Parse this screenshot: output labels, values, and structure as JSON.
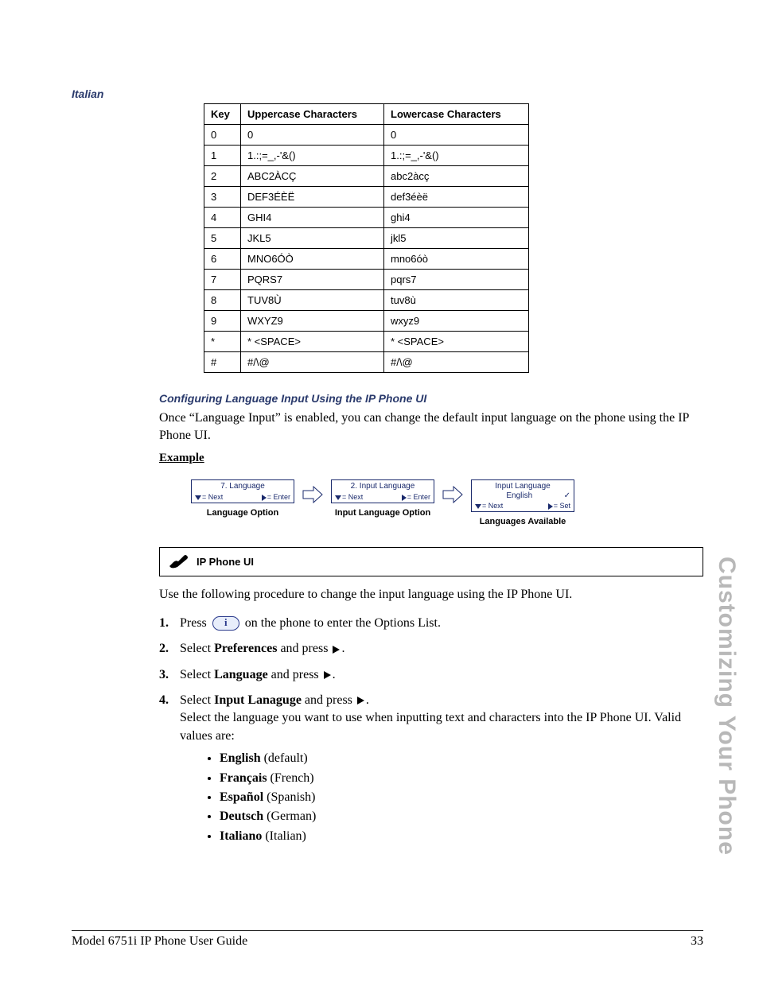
{
  "section_label": "Italian",
  "table": {
    "headers": {
      "key": "Key",
      "upper": "Uppercase Characters",
      "lower": "Lowercase Characters"
    },
    "rows": [
      {
        "k": "0",
        "u": "0",
        "l": "0"
      },
      {
        "k": "1",
        "u": "1.:;=_,-'&()",
        "l": "1.:;=_,-'&()"
      },
      {
        "k": "2",
        "u": "ABC2ÀCÇ",
        "l": "abc2àcç"
      },
      {
        "k": "3",
        "u": "DEF3ÉÈË",
        "l": "def3éèë"
      },
      {
        "k": "4",
        "u": "GHI4",
        "l": "ghi4"
      },
      {
        "k": "5",
        "u": "JKL5",
        "l": "jkl5"
      },
      {
        "k": "6",
        "u": "MNO6ÓÒ",
        "l": "mno6óò"
      },
      {
        "k": "7",
        "u": "PQRS7",
        "l": "pqrs7"
      },
      {
        "k": "8",
        "u": "TUV8Ù",
        "l": "tuv8ù"
      },
      {
        "k": "9",
        "u": "WXYZ9",
        "l": "wxyz9"
      },
      {
        "k": "*",
        "u": "* <SPACE>",
        "l": "* <SPACE>"
      },
      {
        "k": "#",
        "u": "#/\\@",
        "l": "#/\\@"
      }
    ]
  },
  "config_heading": "Configuring Language Input Using the IP Phone UI",
  "config_intro": "Once “Language Input” is enabled, you can change the default input language on the phone using the IP Phone UI.",
  "example_label": "Example",
  "screens": {
    "s1": {
      "title": "7. Language",
      "left": "= Next",
      "right": "= Enter",
      "caption": "Language Option"
    },
    "s2": {
      "title": "2. Input Language",
      "left": "= Next",
      "right": "= Enter",
      "caption": "Input Language Option"
    },
    "s3": {
      "title": "Input Language",
      "sub": "English",
      "left": "= Next",
      "right": "= Set",
      "caption": "Languages Available"
    }
  },
  "proc_label": "IP Phone UI",
  "proc_intro": "Use the following procedure to change the input language using the IP Phone UI.",
  "steps": {
    "s1a": "Press ",
    "s1b": " on the phone to enter the Options List.",
    "s2a": "Select ",
    "s2b": "Preferences",
    "s2c": " and press ",
    "s3a": "Select ",
    "s3b": "Language",
    "s3c": " and press ",
    "s4a": "Select ",
    "s4b": "Input Lanaguge",
    "s4c": " and press ",
    "s4d": "Select the language you want to use when inputting text and characters into the IP Phone UI. Valid values are:"
  },
  "languages": [
    {
      "bold": "English",
      "rest": " (default)"
    },
    {
      "bold": "Français",
      "rest": " (French)"
    },
    {
      "bold": "Español",
      "rest": " (Spanish)"
    },
    {
      "bold": "Deutsch",
      "rest": " (German)"
    },
    {
      "bold": "Italiano",
      "rest": " (Italian)"
    }
  ],
  "side_tab": "Customizing Your Phone",
  "footer": {
    "left": "Model 6751i IP Phone User Guide",
    "right": "33"
  }
}
